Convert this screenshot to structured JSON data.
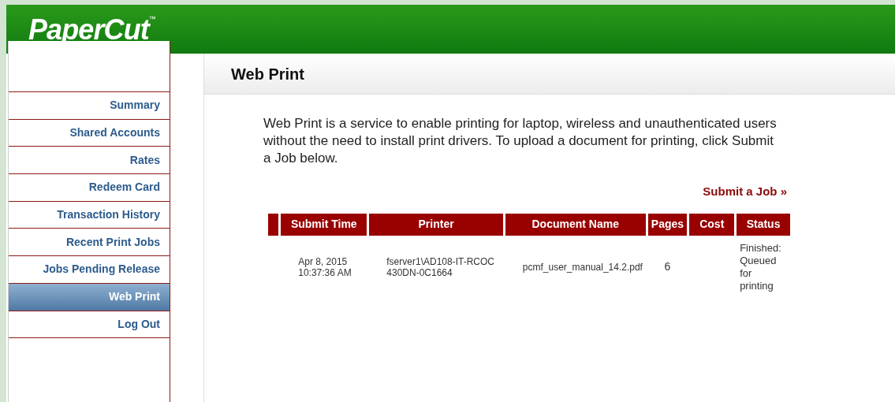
{
  "logo": "PaperCut",
  "logo_mark": "™",
  "nav": [
    {
      "label": "Summary",
      "selected": false
    },
    {
      "label": "Shared Accounts",
      "selected": false
    },
    {
      "label": "Rates",
      "selected": false
    },
    {
      "label": "Redeem Card",
      "selected": false
    },
    {
      "label": "Transaction History",
      "selected": false
    },
    {
      "label": "Recent Print Jobs",
      "selected": false
    },
    {
      "label": "Jobs Pending Release",
      "selected": false
    },
    {
      "label": "Web Print",
      "selected": true
    },
    {
      "label": "Log Out",
      "selected": false
    }
  ],
  "page_title": "Web Print",
  "intro": "Web Print is a service to enable printing for laptop, wireless and unauthenticated users without the need to install print drivers. To upload a document for printing, click Submit a Job below.",
  "submit_link": "Submit a Job »",
  "table": {
    "columns": [
      "Submit Time",
      "Printer",
      "Document Name",
      "Pages",
      "Cost",
      "Status"
    ],
    "rows": [
      {
        "submit_time": "Apr 8, 2015 10:37:36 AM",
        "printer": "fserver1\\AD108-IT-RCOC430DN-0C1664",
        "document_name": "pcmf_user_manual_14.2.pdf",
        "pages": "6",
        "status": "Finished: Queued for printing"
      }
    ]
  }
}
